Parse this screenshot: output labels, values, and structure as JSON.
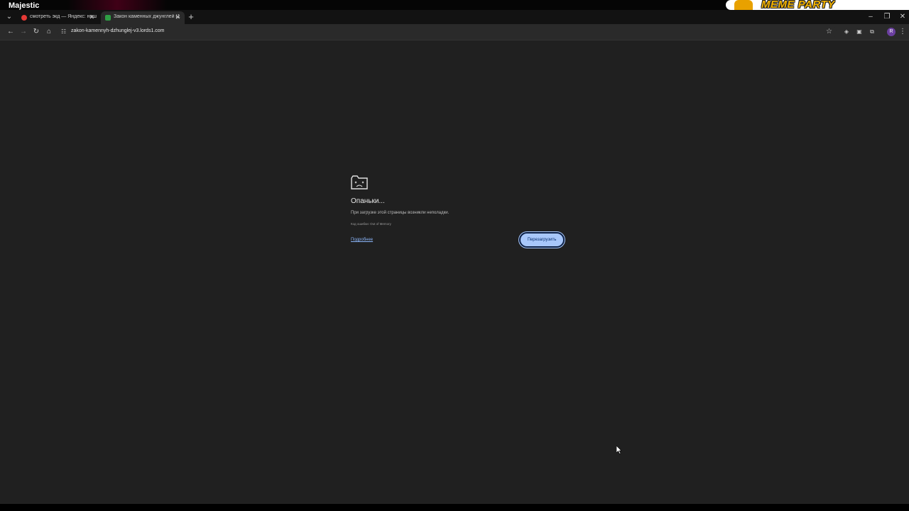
{
  "overlay": {
    "left_text": "Majestic",
    "banner_text": "MEME PARTY"
  },
  "tabs": [
    {
      "title": "смотреть экд — Яндекс: нашл",
      "active": false
    },
    {
      "title": "Закон каменных джунглей (1",
      "active": true
    }
  ],
  "toolbar": {
    "url": "zakon-kamennyh-dzhunglej-v3.lords1.com",
    "profile_initial": "R"
  },
  "error_page": {
    "title": "Опаньки...",
    "description": "При загрузке этой страницы возникли неполадки.",
    "error_code": "Код ошибки: Out of Memory",
    "details_link": "Подробнее",
    "reload_button": "Перезагрузить"
  },
  "colors": {
    "page_bg": "#202020",
    "button_bg": "#a8c7fa",
    "link": "#8ab4f8"
  }
}
